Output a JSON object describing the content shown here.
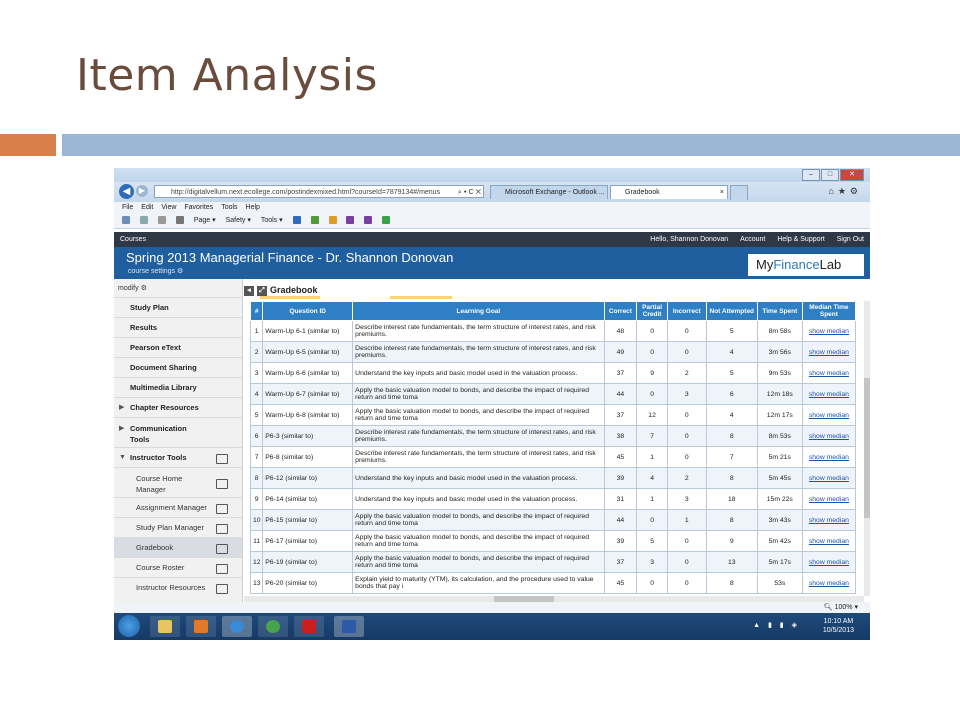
{
  "slide": {
    "title": "Item Analysis"
  },
  "browser": {
    "url": "http://digitalvellum.next.ecollege.com/postindexmixed.html?courseId=7879134#/menus",
    "tabs": [
      {
        "label": "Microsoft Exchange - Outlook ..."
      },
      {
        "label": "Gradebook",
        "close": "×"
      }
    ],
    "menu": [
      "File",
      "Edit",
      "View",
      "Favorites",
      "Tools",
      "Help"
    ],
    "commands": [
      "Page ▾",
      "Safety ▾",
      "Tools ▾"
    ],
    "status_zoom": "100%",
    "window_buttons": [
      "–",
      "□",
      "✕"
    ]
  },
  "app": {
    "courses_label": "Courses",
    "user_greeting": "Hello, Shannon Donovan",
    "links": [
      "Account",
      "Help & Support",
      "Sign Out"
    ],
    "course_title": "Spring 2013 Managerial Finance - Dr. Shannon Donovan",
    "course_settings": "course settings",
    "logo_my": "My",
    "logo_finance": "Finance",
    "logo_lab": "Lab"
  },
  "sidebar": {
    "modify": "modify",
    "items": [
      {
        "label": "Study Plan"
      },
      {
        "label": "Results"
      },
      {
        "label": "Pearson eText"
      },
      {
        "label": "Document Sharing"
      },
      {
        "label": "Multimedia Library"
      },
      {
        "label": "Chapter Resources"
      },
      {
        "label": "Communication"
      },
      {
        "label": "Tools"
      },
      {
        "label": "Instructor Tools"
      },
      {
        "label": "Course Home"
      },
      {
        "label": "Manager"
      },
      {
        "label": "Assignment Manager"
      },
      {
        "label": "Study Plan Manager"
      },
      {
        "label": "Gradebook"
      },
      {
        "label": "Course Roster"
      },
      {
        "label": "Instructor Resources"
      }
    ]
  },
  "gradebook": {
    "title": "Gradebook",
    "headers": [
      "#",
      "Question ID",
      "Learning Goal",
      "Correct",
      "Partial Credit",
      "Incorrect",
      "Not Attempted",
      "Time Spent",
      "Median Time Spent"
    ],
    "rows": [
      [
        "1",
        "Warm-Up 6-1 (similar to)",
        "Describe interest rate fundamentals, the term structure of interest rates, and risk premiums.",
        "48",
        "0",
        "0",
        "5",
        "8m 58s",
        "show median"
      ],
      [
        "2",
        "Warm-Up 6-5 (similar to)",
        "Describe interest rate fundamentals, the term structure of interest rates, and risk premiums.",
        "49",
        "0",
        "0",
        "4",
        "3m 56s",
        "show median"
      ],
      [
        "3",
        "Warm-Up 6-6 (similar to)",
        "Understand the key inputs and basic model used in the valuation process.",
        "37",
        "9",
        "2",
        "5",
        "9m 53s",
        "show median"
      ],
      [
        "4",
        "Warm-Up 6-7 (similar to)",
        "Apply the basic valuation model to bonds, and describe the impact of required return and time toma",
        "44",
        "0",
        "3",
        "6",
        "12m 18s",
        "show median"
      ],
      [
        "5",
        "Warm-Up 6-8 (similar to)",
        "Apply the basic valuation model to bonds, and describe the impact of required return and time toma",
        "37",
        "12",
        "0",
        "4",
        "12m 17s",
        "show median"
      ],
      [
        "6",
        "P6-3 (similar to)",
        "Describe interest rate fundamentals, the term structure of interest rates, and risk premiums.",
        "38",
        "7",
        "0",
        "8",
        "8m 53s",
        "show median"
      ],
      [
        "7",
        "P6-8 (similar to)",
        "Describe interest rate fundamentals, the term structure of interest rates, and risk premiums.",
        "45",
        "1",
        "0",
        "7",
        "5m 21s",
        "show median"
      ],
      [
        "8",
        "P6-12 (similar to)",
        "Understand the key inputs and basic model used in the valuation process.",
        "39",
        "4",
        "2",
        "8",
        "5m 45s",
        "show median"
      ],
      [
        "9",
        "P6-14 (similar to)",
        "Understand the key inputs and basic model used in the valuation process.",
        "31",
        "1",
        "3",
        "18",
        "15m 22s",
        "show median"
      ],
      [
        "10",
        "P6-15 (similar to)",
        "Apply the basic valuation model to bonds, and describe the impact of required return and time toma",
        "44",
        "0",
        "1",
        "8",
        "3m 43s",
        "show median"
      ],
      [
        "11",
        "P6-17 (similar to)",
        "Apply the basic valuation model to bonds, and describe the impact of required return and time toma",
        "39",
        "5",
        "0",
        "9",
        "5m 42s",
        "show median"
      ],
      [
        "12",
        "P6-19 (similar to)",
        "Apply the basic valuation model to bonds, and describe the impact of required return and time toma",
        "37",
        "3",
        "0",
        "13",
        "5m 17s",
        "show median"
      ],
      [
        "13",
        "P6-20 (similar to)",
        "Explain yield to maturity (YTM), its calculation, and the procedure used to value bonds that pay i",
        "45",
        "0",
        "0",
        "8",
        "53s",
        "show median"
      ]
    ]
  },
  "taskbar": {
    "time": "10:10 AM",
    "date": "10/5/2013"
  },
  "colors": {
    "header_blue": "#1f5fa0",
    "table_header": "#2f7fc4",
    "accent_orange": "#d9804a",
    "accent_blue": "#9ab6d4"
  }
}
